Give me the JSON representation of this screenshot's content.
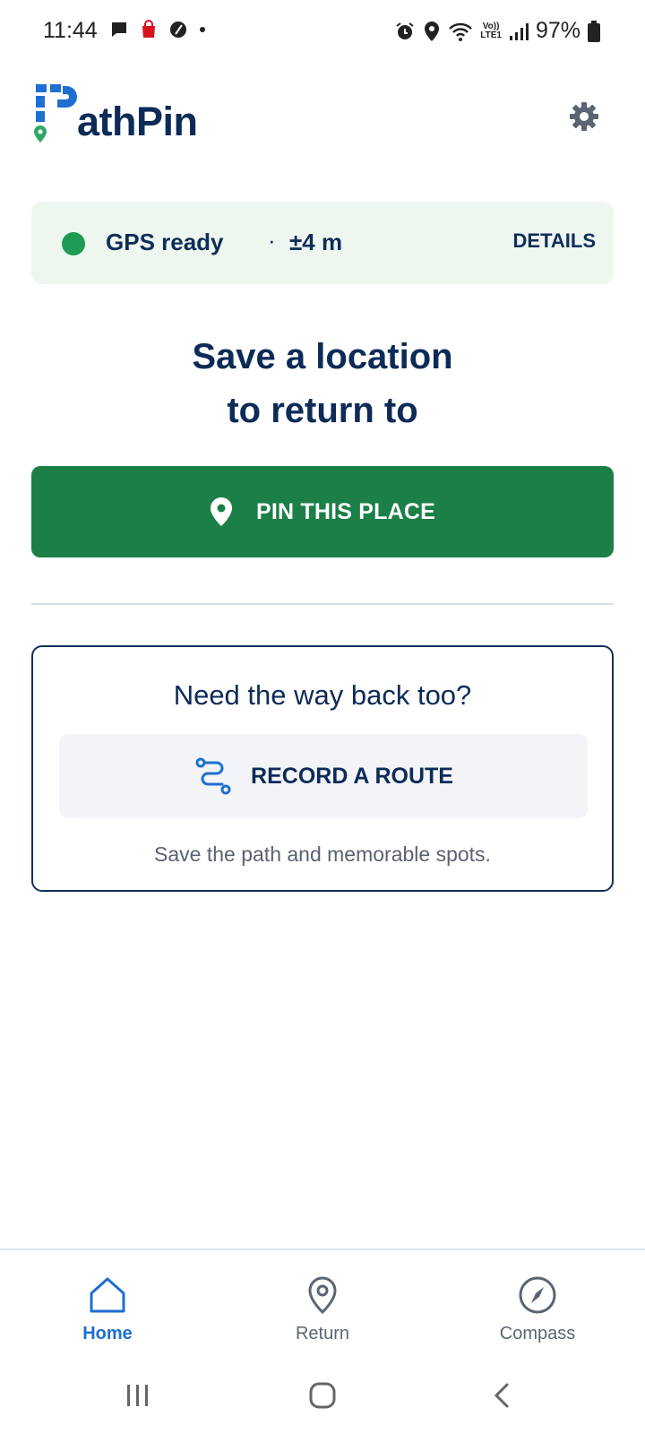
{
  "status_bar": {
    "time": "11:44",
    "network_top": "Vo))",
    "network_bottom": "LTE1",
    "battery": "97%"
  },
  "header": {
    "logo_text": "athPin",
    "settings_icon": "gear-icon"
  },
  "gps": {
    "status": "GPS ready",
    "separator": "·",
    "accuracy": "±4 m",
    "details_label": "DETAILS",
    "status_color": "#1e9b54"
  },
  "main": {
    "heading_line1": "Save a location",
    "heading_line2": "to return to",
    "pin_button_label": "PIN THIS PLACE",
    "pin_icon": "map-pin-icon",
    "accent_color": "#1b7f47"
  },
  "route_card": {
    "title": "Need the way back too?",
    "button_label": "RECORD A ROUTE",
    "button_icon": "route-icon",
    "subtitle": "Save the path and memorable spots."
  },
  "bottom_nav": {
    "items": [
      {
        "label": "Home",
        "icon": "home-icon",
        "active": true
      },
      {
        "label": "Return",
        "icon": "location-pin-icon",
        "active": false
      },
      {
        "label": "Compass",
        "icon": "compass-icon",
        "active": false
      }
    ]
  }
}
